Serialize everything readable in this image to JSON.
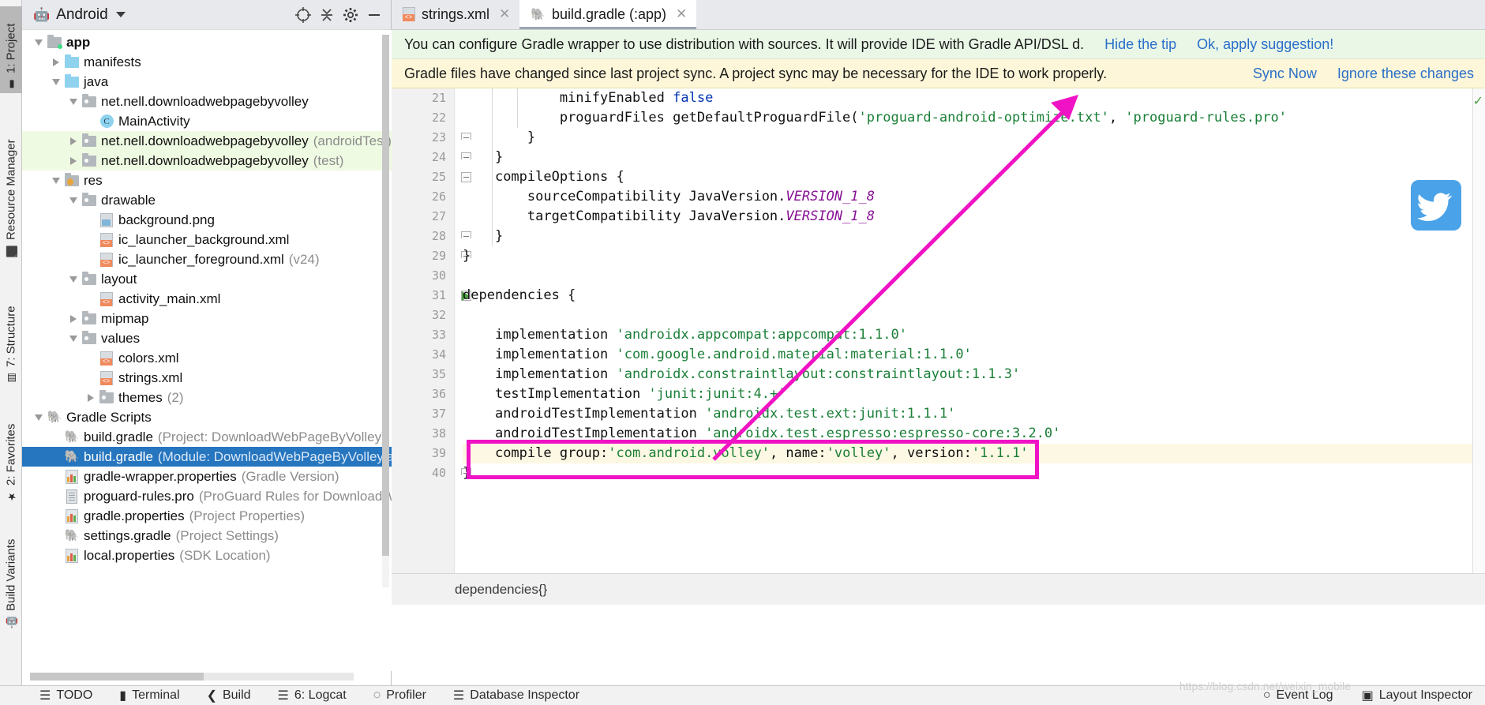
{
  "left_strip": {
    "tabs": [
      {
        "label": "1: Project",
        "icon": "project-icon",
        "active": true
      },
      {
        "label": "Resource Manager",
        "icon": "resource-icon",
        "active": false
      },
      {
        "label": "7: Structure",
        "icon": "structure-icon",
        "active": false
      },
      {
        "label": "2: Favorites",
        "icon": "star-icon",
        "active": false
      },
      {
        "label": "Build Variants",
        "icon": "android-icon",
        "active": false
      }
    ]
  },
  "project_panel": {
    "title": "Android",
    "icons": [
      "target-icon",
      "collapse-all-icon",
      "gear-icon",
      "minimize-icon"
    ],
    "tree": [
      {
        "depth": 0,
        "twist": "down",
        "icon": "folder-app",
        "label": "app",
        "sub": "",
        "bold": true,
        "selected": false,
        "tint": ""
      },
      {
        "depth": 1,
        "twist": "right",
        "icon": "folder-blue",
        "label": "manifests",
        "sub": "",
        "bold": false,
        "selected": false,
        "tint": ""
      },
      {
        "depth": 1,
        "twist": "down",
        "icon": "folder-blue",
        "label": "java",
        "sub": "",
        "bold": false,
        "selected": false,
        "tint": ""
      },
      {
        "depth": 2,
        "twist": "down",
        "icon": "folder-package",
        "label": "net.nell.downloadwebpagebyvolley",
        "sub": "",
        "bold": false,
        "selected": false,
        "tint": ""
      },
      {
        "depth": 3,
        "twist": "none",
        "icon": "class-icon",
        "label": "MainActivity",
        "sub": "",
        "bold": false,
        "selected": false,
        "tint": ""
      },
      {
        "depth": 2,
        "twist": "right",
        "icon": "folder-package",
        "label": "net.nell.downloadwebpagebyvolley",
        "sub": "(androidTest)",
        "bold": false,
        "selected": false,
        "tint": "green"
      },
      {
        "depth": 2,
        "twist": "right",
        "icon": "folder-package",
        "label": "net.nell.downloadwebpagebyvolley",
        "sub": "(test)",
        "bold": false,
        "selected": false,
        "tint": "green"
      },
      {
        "depth": 1,
        "twist": "down",
        "icon": "folder-res",
        "label": "res",
        "sub": "",
        "bold": false,
        "selected": false,
        "tint": ""
      },
      {
        "depth": 2,
        "twist": "down",
        "icon": "folder-package",
        "label": "drawable",
        "sub": "",
        "bold": false,
        "selected": false,
        "tint": ""
      },
      {
        "depth": 3,
        "twist": "none",
        "icon": "png-icon",
        "label": "background.png",
        "sub": "",
        "bold": false,
        "selected": false,
        "tint": ""
      },
      {
        "depth": 3,
        "twist": "none",
        "icon": "xml-icon",
        "label": "ic_launcher_background.xml",
        "sub": "",
        "bold": false,
        "selected": false,
        "tint": ""
      },
      {
        "depth": 3,
        "twist": "none",
        "icon": "xml-icon",
        "label": "ic_launcher_foreground.xml",
        "sub": "(v24)",
        "bold": false,
        "selected": false,
        "tint": ""
      },
      {
        "depth": 2,
        "twist": "down",
        "icon": "folder-package",
        "label": "layout",
        "sub": "",
        "bold": false,
        "selected": false,
        "tint": ""
      },
      {
        "depth": 3,
        "twist": "none",
        "icon": "xml-icon",
        "label": "activity_main.xml",
        "sub": "",
        "bold": false,
        "selected": false,
        "tint": ""
      },
      {
        "depth": 2,
        "twist": "right",
        "icon": "folder-package",
        "label": "mipmap",
        "sub": "",
        "bold": false,
        "selected": false,
        "tint": ""
      },
      {
        "depth": 2,
        "twist": "down",
        "icon": "folder-package",
        "label": "values",
        "sub": "",
        "bold": false,
        "selected": false,
        "tint": ""
      },
      {
        "depth": 3,
        "twist": "none",
        "icon": "xml-icon",
        "label": "colors.xml",
        "sub": "",
        "bold": false,
        "selected": false,
        "tint": ""
      },
      {
        "depth": 3,
        "twist": "none",
        "icon": "xml-icon",
        "label": "strings.xml",
        "sub": "",
        "bold": false,
        "selected": false,
        "tint": ""
      },
      {
        "depth": 3,
        "twist": "right",
        "icon": "folder-package",
        "label": "themes",
        "sub": "(2)",
        "bold": false,
        "selected": false,
        "tint": ""
      },
      {
        "depth": 0,
        "twist": "down",
        "icon": "gradle-icon",
        "label": "Gradle Scripts",
        "sub": "",
        "bold": false,
        "selected": false,
        "tint": ""
      },
      {
        "depth": 1,
        "twist": "none",
        "icon": "gradle-light",
        "label": "build.gradle",
        "sub": "(Project: DownloadWebPageByVolley)",
        "bold": false,
        "selected": false,
        "tint": ""
      },
      {
        "depth": 1,
        "twist": "none",
        "icon": "gradle-light",
        "label": "build.gradle",
        "sub": "(Module: DownloadWebPageByVolley.app)",
        "bold": false,
        "selected": true,
        "tint": ""
      },
      {
        "depth": 1,
        "twist": "none",
        "icon": "prop-icon",
        "label": "gradle-wrapper.properties",
        "sub": "(Gradle Version)",
        "bold": false,
        "selected": false,
        "tint": ""
      },
      {
        "depth": 1,
        "twist": "none",
        "icon": "doc-icon",
        "label": "proguard-rules.pro",
        "sub": "(ProGuard Rules for DownloadWebP",
        "bold": false,
        "selected": false,
        "tint": ""
      },
      {
        "depth": 1,
        "twist": "none",
        "icon": "prop-icon",
        "label": "gradle.properties",
        "sub": "(Project Properties)",
        "bold": false,
        "selected": false,
        "tint": ""
      },
      {
        "depth": 1,
        "twist": "none",
        "icon": "gradle-light",
        "label": "settings.gradle",
        "sub": "(Project Settings)",
        "bold": false,
        "selected": false,
        "tint": ""
      },
      {
        "depth": 1,
        "twist": "none",
        "icon": "prop-icon",
        "label": "local.properties",
        "sub": "(SDK Location)",
        "bold": false,
        "selected": false,
        "tint": ""
      }
    ]
  },
  "editor": {
    "tabs": [
      {
        "label": "strings.xml",
        "icon": "xml-icon",
        "active": false
      },
      {
        "label": "build.gradle (:app)",
        "icon": "gradle-icon",
        "active": true
      }
    ],
    "notifications": [
      {
        "kind": "tip",
        "message": "You can configure Gradle wrapper to use distribution with sources. It will provide IDE with Gradle API/DSL d.",
        "actions": [
          "Hide the tip",
          "Ok, apply suggestion!"
        ]
      },
      {
        "kind": "sync",
        "message": "Gradle files have changed since last project sync. A project sync may be necessary for the IDE to work properly.",
        "actions": [
          "Sync Now",
          "Ignore these changes"
        ]
      }
    ],
    "first_line_number": 21,
    "lines": [
      {
        "n": 21,
        "fold": "",
        "run": false,
        "hl": false,
        "indent": 3,
        "tokens": [
          {
            "t": "minifyEnabled ",
            "c": "plain"
          },
          {
            "t": "false",
            "c": "kw"
          }
        ]
      },
      {
        "n": 22,
        "fold": "",
        "run": false,
        "hl": false,
        "indent": 3,
        "tokens": [
          {
            "t": "proguardFiles getDefaultProguardFile(",
            "c": "plain"
          },
          {
            "t": "'proguard-android-optimize.txt'",
            "c": "str"
          },
          {
            "t": ", ",
            "c": "plain"
          },
          {
            "t": "'proguard-rules.pro'",
            "c": "str"
          }
        ]
      },
      {
        "n": 23,
        "fold": "end",
        "run": false,
        "hl": false,
        "indent": 2,
        "tokens": [
          {
            "t": "}",
            "c": "plain"
          }
        ]
      },
      {
        "n": 24,
        "fold": "end",
        "run": false,
        "hl": false,
        "indent": 1,
        "tokens": [
          {
            "t": "}",
            "c": "plain"
          }
        ]
      },
      {
        "n": 25,
        "fold": "open",
        "run": false,
        "hl": false,
        "indent": 1,
        "tokens": [
          {
            "t": "compileOptions {",
            "c": "plain"
          }
        ]
      },
      {
        "n": 26,
        "fold": "",
        "run": false,
        "hl": false,
        "indent": 2,
        "tokens": [
          {
            "t": "sourceCompatibility JavaVersion.",
            "c": "plain"
          },
          {
            "t": "VERSION_1_8",
            "c": "fld"
          }
        ]
      },
      {
        "n": 27,
        "fold": "",
        "run": false,
        "hl": false,
        "indent": 2,
        "tokens": [
          {
            "t": "targetCompatibility JavaVersion.",
            "c": "plain"
          },
          {
            "t": "VERSION_1_8",
            "c": "fld"
          }
        ]
      },
      {
        "n": 28,
        "fold": "end",
        "run": false,
        "hl": false,
        "indent": 1,
        "tokens": [
          {
            "t": "}",
            "c": "plain"
          }
        ]
      },
      {
        "n": 29,
        "fold": "end",
        "run": false,
        "hl": false,
        "indent": 0,
        "tokens": [
          {
            "t": "}",
            "c": "plain"
          }
        ]
      },
      {
        "n": 30,
        "fold": "",
        "run": false,
        "hl": false,
        "indent": 0,
        "tokens": []
      },
      {
        "n": 31,
        "fold": "open",
        "run": true,
        "hl": false,
        "indent": 0,
        "tokens": [
          {
            "t": "dependencies {",
            "c": "plain"
          }
        ]
      },
      {
        "n": 32,
        "fold": "",
        "run": false,
        "hl": false,
        "indent": 0,
        "tokens": []
      },
      {
        "n": 33,
        "fold": "",
        "run": false,
        "hl": false,
        "indent": 1,
        "tokens": [
          {
            "t": "implementation ",
            "c": "plain"
          },
          {
            "t": "'androidx.appcompat:appcompat:1.1.0'",
            "c": "str"
          }
        ]
      },
      {
        "n": 34,
        "fold": "",
        "run": false,
        "hl": false,
        "indent": 1,
        "tokens": [
          {
            "t": "implementation ",
            "c": "plain"
          },
          {
            "t": "'com.google.android.material:material:1.1.0'",
            "c": "str"
          }
        ]
      },
      {
        "n": 35,
        "fold": "",
        "run": false,
        "hl": false,
        "indent": 1,
        "tokens": [
          {
            "t": "implementation ",
            "c": "plain"
          },
          {
            "t": "'androidx.constraintlayout:constraintlayout:1.1.3'",
            "c": "str"
          }
        ]
      },
      {
        "n": 36,
        "fold": "",
        "run": false,
        "hl": false,
        "indent": 1,
        "tokens": [
          {
            "t": "testImplementation ",
            "c": "plain"
          },
          {
            "t": "'junit:junit:4.+'",
            "c": "str"
          }
        ]
      },
      {
        "n": 37,
        "fold": "",
        "run": false,
        "hl": false,
        "indent": 1,
        "tokens": [
          {
            "t": "androidTestImplementation ",
            "c": "plain"
          },
          {
            "t": "'androidx.test.ext:junit:1.1.1'",
            "c": "str"
          }
        ]
      },
      {
        "n": 38,
        "fold": "",
        "run": false,
        "hl": false,
        "indent": 1,
        "tokens": [
          {
            "t": "androidTestImplementation ",
            "c": "plain"
          },
          {
            "t": "'androidx.test.espresso:espresso-core:3.2.0'",
            "c": "str"
          }
        ]
      },
      {
        "n": 39,
        "fold": "",
        "run": false,
        "hl": true,
        "indent": 1,
        "tokens": [
          {
            "t": "compile group:",
            "c": "plain"
          },
          {
            "t": "'com.android.volley'",
            "c": "str"
          },
          {
            "t": ", name:",
            "c": "plain"
          },
          {
            "t": "'volley'",
            "c": "str"
          },
          {
            "t": ", version:",
            "c": "plain"
          },
          {
            "t": "'1.1.1'",
            "c": "str"
          }
        ]
      },
      {
        "n": 40,
        "fold": "end",
        "run": false,
        "hl": false,
        "indent": 0,
        "tokens": [
          {
            "t": "}",
            "c": "plain"
          }
        ]
      }
    ],
    "breadcrumb": "dependencies{}"
  },
  "annotation": {
    "highlight_color": "#f013c5",
    "highlighted_line": 39,
    "arrow_target": "Sync Now"
  },
  "bottom_bar": {
    "items": [
      {
        "label": "TODO",
        "icon": "todo-icon"
      },
      {
        "label": "Terminal",
        "icon": "terminal-icon"
      },
      {
        "label": "Build",
        "icon": "build-icon"
      },
      {
        "label": "6: Logcat",
        "icon": "logcat-icon"
      },
      {
        "label": "Profiler",
        "icon": "profiler-icon"
      },
      {
        "label": "Database Inspector",
        "icon": "database-icon"
      }
    ],
    "right_items": [
      {
        "label": "Event Log",
        "icon": "event-log-icon"
      },
      {
        "label": "Layout Inspector",
        "icon": "layout-inspector-icon"
      }
    ]
  },
  "watermark": "https://blog.csdn.net/weixin_mobile"
}
